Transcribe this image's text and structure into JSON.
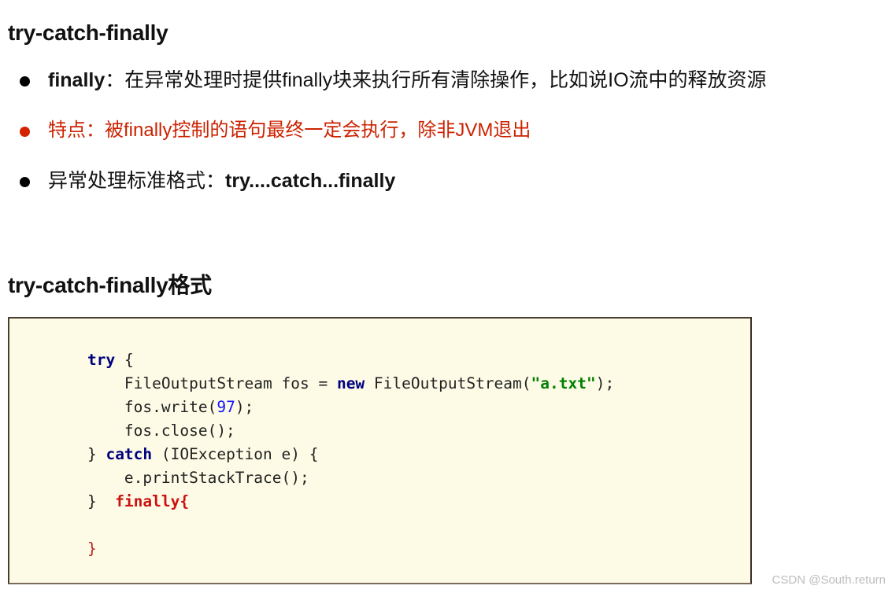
{
  "headings": {
    "main": "try-catch-finally",
    "format": "try-catch-finally格式"
  },
  "bullets": [
    {
      "marker_color": "#000000",
      "text_color": "#141414",
      "lead": "finally",
      "lead_bold": true,
      "rest": "：在异常处理时提供finally块来执行所有清除操作，比如说IO流中的释放资源",
      "rest_bold": false
    },
    {
      "marker_color": "#d42200",
      "text_color": "#cc2200",
      "lead": "特点：被finally控制的语句最终一定会执行，除非JVM退出",
      "lead_bold": false,
      "rest": "",
      "rest_bold": false
    },
    {
      "marker_color": "#000000",
      "text_color": "#141414",
      "lead": "异常处理标准格式：",
      "lead_bold": false,
      "rest": "try....catch...finally",
      "rest_bold": true
    }
  ],
  "code": {
    "language": "java",
    "background": "#fdfbe6",
    "lines": [
      [
        {
          "t": "    ",
          "c": "plain"
        },
        {
          "t": "try",
          "c": "kw"
        },
        {
          "t": " {",
          "c": "plain"
        }
      ],
      [
        {
          "t": "        FileOutputStream fos = ",
          "c": "plain"
        },
        {
          "t": "new",
          "c": "kw"
        },
        {
          "t": " FileOutputStream(",
          "c": "plain"
        },
        {
          "t": "\"a.txt\"",
          "c": "str"
        },
        {
          "t": ");",
          "c": "plain"
        }
      ],
      [
        {
          "t": "        fos.write(",
          "c": "plain"
        },
        {
          "t": "97",
          "c": "num"
        },
        {
          "t": ");",
          "c": "plain"
        }
      ],
      [
        {
          "t": "        fos.close();",
          "c": "plain"
        }
      ],
      [
        {
          "t": "    } ",
          "c": "plain"
        },
        {
          "t": "catch",
          "c": "kw"
        },
        {
          "t": " (IOException e) {",
          "c": "plain"
        }
      ],
      [
        {
          "t": "        e.printStackTrace();",
          "c": "plain"
        }
      ],
      [
        {
          "t": "    }  ",
          "c": "plain"
        },
        {
          "t": "finally",
          "c": "fin"
        },
        {
          "t": "{",
          "c": "fin"
        }
      ],
      [
        {
          "t": "",
          "c": "plain"
        }
      ],
      [
        {
          "t": "    }",
          "c": "brace-r"
        }
      ]
    ]
  },
  "watermark": "CSDN @South.return"
}
